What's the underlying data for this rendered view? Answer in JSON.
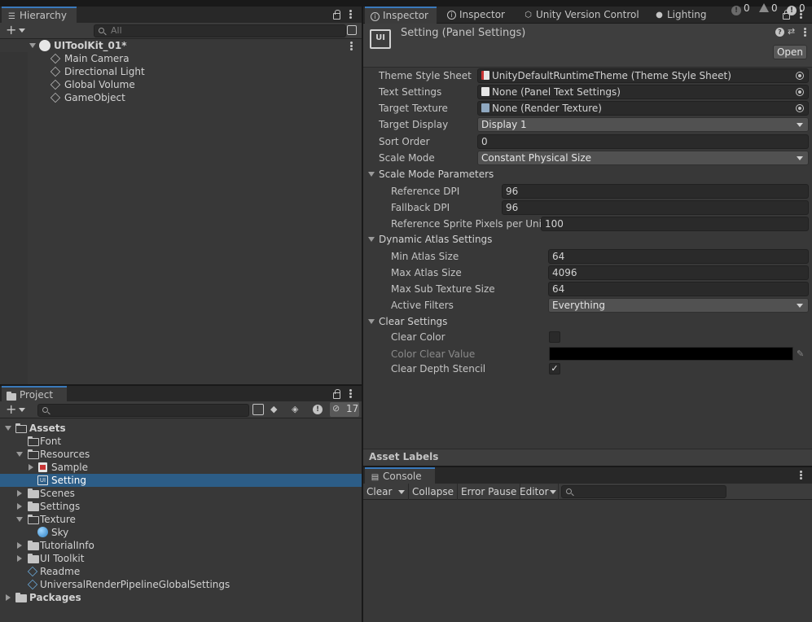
{
  "hierarchy": {
    "tab_label": "Hierarchy",
    "search_placeholder": "All",
    "scene": "UIToolKit_01*",
    "items": [
      "Main Camera",
      "Directional Light",
      "Global Volume",
      "GameObject"
    ]
  },
  "project": {
    "tab_label": "Project",
    "hidden_count": "17",
    "tree": [
      {
        "label": "Assets",
        "bold": true,
        "expanded": true
      },
      {
        "label": "Font"
      },
      {
        "label": "Resources",
        "expanded": true
      },
      {
        "label": "Sample"
      },
      {
        "label": "Setting",
        "selected": true
      },
      {
        "label": "Scenes"
      },
      {
        "label": "Settings"
      },
      {
        "label": "Texture",
        "expanded": true
      },
      {
        "label": "Sky"
      },
      {
        "label": "TutorialInfo"
      },
      {
        "label": "UI Toolkit"
      },
      {
        "label": "Readme"
      },
      {
        "label": "UniversalRenderPipelineGlobalSettings"
      },
      {
        "label": "Packages",
        "bold": true
      }
    ]
  },
  "inspector": {
    "tabs": [
      "Inspector",
      "Inspector",
      "Unity Version Control",
      "Lighting"
    ],
    "title": "Setting (Panel Settings)",
    "open_button": "Open",
    "fields": {
      "theme_style_sheet": {
        "label": "Theme Style Sheet",
        "value": "UnityDefaultRuntimeTheme (Theme Style Sheet)"
      },
      "text_settings": {
        "label": "Text Settings",
        "value": "None (Panel Text Settings)"
      },
      "target_texture": {
        "label": "Target Texture",
        "value": "None (Render Texture)"
      },
      "target_display": {
        "label": "Target Display",
        "value": "Display 1"
      },
      "sort_order": {
        "label": "Sort Order",
        "value": "0"
      },
      "scale_mode": {
        "label": "Scale Mode",
        "value": "Constant Physical Size"
      }
    },
    "scale_mode_parameters": {
      "header": "Scale Mode Parameters",
      "reference_dpi": {
        "label": "Reference DPI",
        "value": "96"
      },
      "fallback_dpi": {
        "label": "Fallback DPI",
        "value": "96"
      },
      "reference_sprite_ppu": {
        "label": "Reference Sprite Pixels per Unit",
        "value": "100"
      }
    },
    "dynamic_atlas": {
      "header": "Dynamic Atlas Settings",
      "min_atlas_size": {
        "label": "Min Atlas Size",
        "value": "64"
      },
      "max_atlas_size": {
        "label": "Max Atlas Size",
        "value": "4096"
      },
      "max_sub_texture_size": {
        "label": "Max Sub Texture Size",
        "value": "64"
      },
      "active_filters": {
        "label": "Active Filters",
        "value": "Everything"
      }
    },
    "clear_settings": {
      "header": "Clear Settings",
      "clear_color": {
        "label": "Clear Color",
        "checked": false
      },
      "color_clear_value": {
        "label": "Color Clear Value",
        "color": "#000000"
      },
      "clear_depth_stencil": {
        "label": "Clear Depth Stencil",
        "checked": true,
        "mark": "✓"
      }
    },
    "asset_labels": "Asset Labels"
  },
  "console": {
    "tab_label": "Console",
    "clear": "Clear",
    "collapse": "Collapse",
    "error_pause": "Error Pause",
    "editor": "Editor",
    "log_count": "0",
    "warn_count": "0",
    "error_count": "0"
  },
  "colors": {
    "accent": "#3a79bb",
    "selection": "#2c5d87",
    "panel": "#383838"
  }
}
